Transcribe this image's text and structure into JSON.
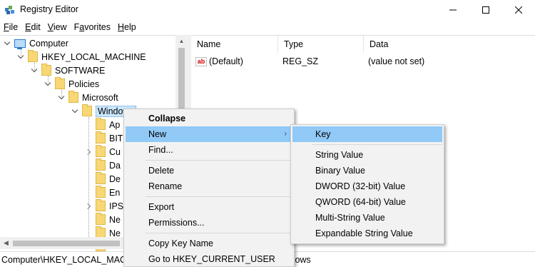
{
  "window": {
    "title": "Registry Editor",
    "controls": {
      "minimize": "—",
      "maximize": "☐",
      "close": "✕"
    }
  },
  "menubar": {
    "items": [
      {
        "label": "File",
        "accel": "F",
        "rest": "ile"
      },
      {
        "label": "Edit",
        "accel": "E",
        "rest": "dit"
      },
      {
        "label": "View",
        "accel": "V",
        "rest": "iew"
      },
      {
        "label": "Favorites",
        "accel": "a",
        "pre": "F",
        "rest": "vorites"
      },
      {
        "label": "Help",
        "accel": "H",
        "rest": "elp"
      }
    ]
  },
  "tree": {
    "nodes": [
      {
        "label": "Computer",
        "icon": "computer-icon"
      },
      {
        "label": "HKEY_LOCAL_MACHINE"
      },
      {
        "label": "SOFTWARE"
      },
      {
        "label": "Policies"
      },
      {
        "label": "Microsoft"
      },
      {
        "label": "Windows",
        "selected": true
      },
      {
        "label": "Ap"
      },
      {
        "label": "BIT"
      },
      {
        "label": "Cu"
      },
      {
        "label": "Da"
      },
      {
        "label": "De"
      },
      {
        "label": "En"
      },
      {
        "label": "IPS"
      },
      {
        "label": "Ne"
      },
      {
        "label": "Ne"
      },
      {
        "label": "Ne"
      }
    ]
  },
  "list": {
    "columns": [
      "Name",
      "Type",
      "Data"
    ],
    "rows": [
      {
        "name": "(Default)",
        "type": "REG_SZ",
        "data": "(value not set)",
        "icon": "ab"
      }
    ]
  },
  "status": {
    "path": "Computer\\HKEY_LOCAL_MACHINE\\SOFTWARE\\Policies\\Microsoft\\Windows"
  },
  "context_menu": {
    "items": [
      "Collapse",
      "New",
      "Find...",
      "Delete",
      "Rename",
      "Export",
      "Permissions...",
      "Copy Key Name",
      "Go to HKEY_CURRENT_USER"
    ],
    "submenu_arrow": "›"
  },
  "submenu": {
    "items": [
      "Key",
      "String Value",
      "Binary Value",
      "DWORD (32-bit) Value",
      "QWORD (64-bit) Value",
      "Multi-String Value",
      "Expandable String Value"
    ]
  },
  "colors": {
    "highlight": "#91c9f7",
    "selection": "#cce8ff",
    "folder": "#f8d775"
  }
}
